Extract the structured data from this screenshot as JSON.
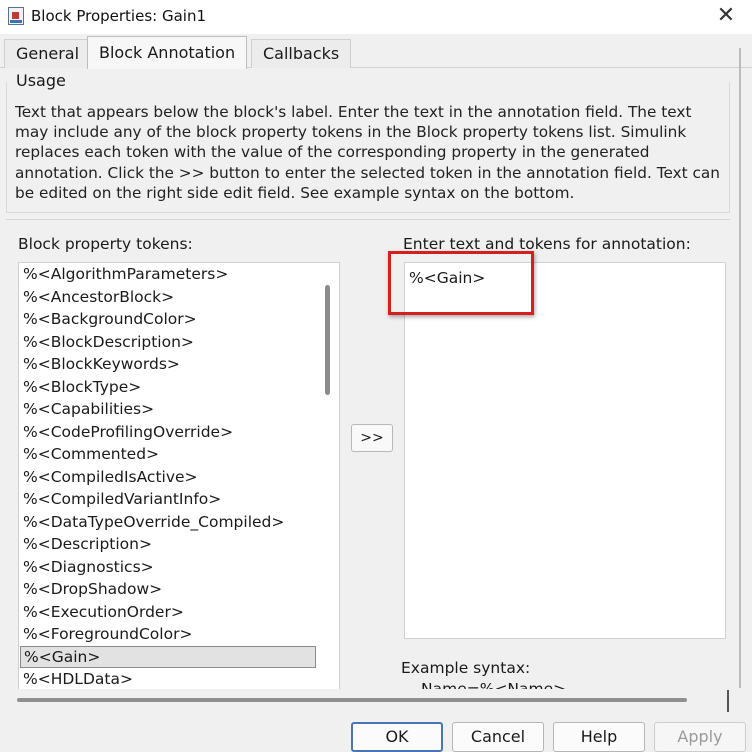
{
  "window": {
    "title": "Block Properties: Gain1",
    "icons": {
      "app": "simulink-block-icon",
      "close": "close-icon"
    }
  },
  "tabs": [
    {
      "label": "General",
      "active": false
    },
    {
      "label": "Block Annotation",
      "active": true
    },
    {
      "label": "Callbacks",
      "active": false
    }
  ],
  "usage": {
    "label": "Usage",
    "text": "Text that appears below the block's label. Enter the text in the annotation field. The text may include any of the block property tokens in the Block property tokens list. Simulink replaces each token with the value of the corresponding property in the generated annotation. Click the >> button to enter the selected token in the annotation field. Text can be edited on the right side edit field. See example syntax on the bottom."
  },
  "tokens": {
    "label": "Block property tokens:",
    "selected": "%<Gain>",
    "items": [
      "%<AlgorithmParameters>",
      "%<AncestorBlock>",
      "%<BackgroundColor>",
      "%<BlockDescription>",
      "%<BlockKeywords>",
      "%<BlockType>",
      "%<Capabilities>",
      "%<CodeProfilingOverride>",
      "%<Commented>",
      "%<CompiledIsActive>",
      "%<CompiledVariantInfo>",
      "%<DataTypeOverride_Compiled>",
      "%<Description>",
      "%<Diagnostics>",
      "%<DropShadow>",
      "%<ExecutionOrder>",
      "%<ForegroundColor>",
      "%<Gain>",
      "%<HDLData>"
    ]
  },
  "move_button": {
    "label": ">>"
  },
  "annotation": {
    "label": "Enter text and tokens for annotation:",
    "value": "%<Gain>"
  },
  "example": {
    "label": "Example syntax:",
    "value": "Name=%<Name>"
  },
  "buttons": {
    "ok": "OK",
    "cancel": "Cancel",
    "help": "Help",
    "apply": "Apply"
  }
}
